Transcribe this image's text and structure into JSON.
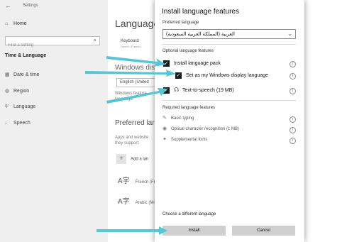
{
  "settings": {
    "app_title": "Settings",
    "back_glyph": "←",
    "home_label": "Home",
    "search_placeholder": "Find a setting",
    "section_title": "Time & Language",
    "nav": [
      {
        "label": "Date & time",
        "icon": "calendar-icon"
      },
      {
        "label": "Region",
        "icon": "globe-icon"
      },
      {
        "label": "Language",
        "icon": "language-icon"
      },
      {
        "label": "Speech",
        "icon": "microphone-icon"
      }
    ]
  },
  "language_page": {
    "heading": "Language",
    "keyboard_title": "Keyboard",
    "keyboard_sub": "French (France)",
    "windows_display_title": "Windows dis",
    "windows_display_value": "English (United",
    "windows_display_desc_1": "Windows feature",
    "windows_display_desc_2": "language.",
    "preferred_title": "Preferred lan",
    "preferred_desc_1": "Apps and website",
    "preferred_desc_2": "they support.",
    "add_language": "Add a lan",
    "languages": [
      "French (Fra",
      "Arabic (Mc"
    ]
  },
  "dialog": {
    "title": "Install language features",
    "preferred_label": "Preferred language",
    "selected_language": "العربية (المملكة العربية السعودية)",
    "optional_label": "Optional language features",
    "optional": [
      {
        "label": "Install language pack",
        "checked": true
      },
      {
        "label": "Set as my Windows display language",
        "checked": true
      },
      {
        "label": "Text-to-speech (19 MB)",
        "checked": true
      }
    ],
    "required_label": "Required language features",
    "required": [
      {
        "label": "Basic typing",
        "icon": "pen-icon"
      },
      {
        "label": "Optical character recognition (1 MB)",
        "icon": "ocr-icon"
      },
      {
        "label": "Supplemental fonts",
        "icon": "sparkle-icon"
      }
    ],
    "choose_label": "Choose a different language",
    "install_label": "Install",
    "cancel_label": "Cancel"
  },
  "colors": {
    "arrow": "#56c6d4",
    "button": "#cfcfcf",
    "sidebar": "#efefef"
  }
}
